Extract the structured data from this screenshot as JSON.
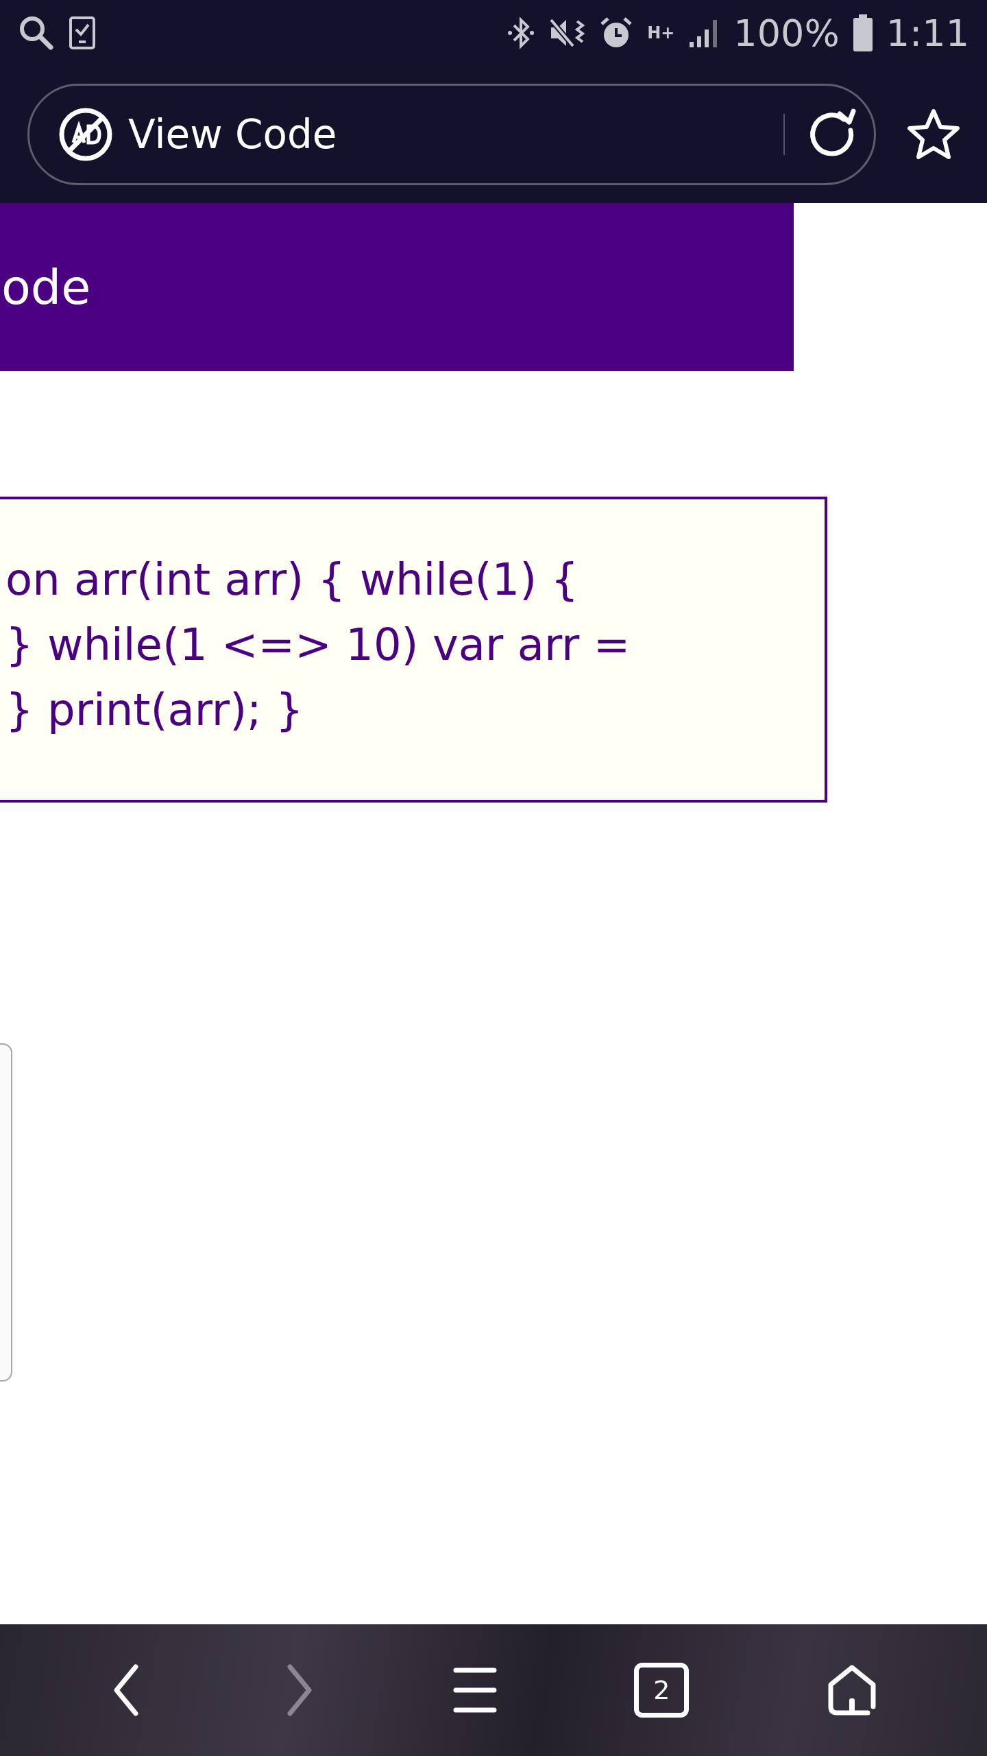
{
  "status_bar": {
    "network": "H+",
    "battery": "100%",
    "time": "1:11"
  },
  "address_bar": {
    "title": "View Code"
  },
  "page": {
    "header_title": "ode",
    "code_lines": [
      "on arr(int arr) { while(1) {",
      "} while(1 <=> 10) var arr =",
      "} print(arr); }"
    ]
  },
  "bottom_nav": {
    "forward": {
      "disabled": true
    },
    "tab_count": "2"
  }
}
